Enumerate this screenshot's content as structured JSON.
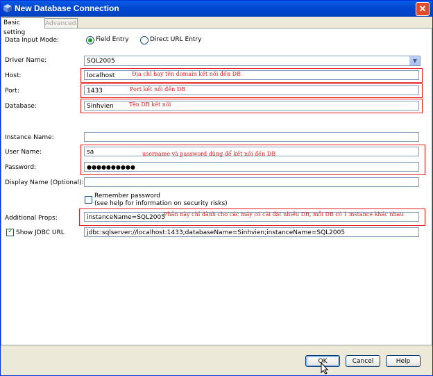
{
  "window": {
    "title": "New Database Connection",
    "close_glyph": "✕"
  },
  "tabs": [
    {
      "label": "Basic setting",
      "active": true
    },
    {
      "label": "Advanced",
      "active": false
    }
  ],
  "form": {
    "data_input_mode": {
      "label": "Data Input Mode:",
      "options": [
        {
          "label": "Field Entry",
          "selected": true
        },
        {
          "label": "Direct URL Entry",
          "selected": false
        }
      ]
    },
    "driver_name": {
      "label": "Driver Name:",
      "value": "SQL2005"
    },
    "host": {
      "label": "Host:",
      "value": "localhost"
    },
    "port": {
      "label": "Port:",
      "value": "1433"
    },
    "database": {
      "label": "Database:",
      "value": "Sinhvien"
    },
    "instance_name": {
      "label": "Instance Name:",
      "value": ""
    },
    "user_name": {
      "label": "User Name:",
      "value": "sa"
    },
    "password": {
      "label": "Password:",
      "value": "●●●●●●●●●●"
    },
    "display_name": {
      "label": "Display Name (Optional):",
      "value": ""
    },
    "remember_password": {
      "label_line1": "Remember password",
      "label_line2": "(see help for information on security risks)",
      "checked": false
    },
    "additional_props": {
      "label": "Additional Props:",
      "value": "instanceName=SQL2005"
    },
    "show_jdbc_url": {
      "label": "Show JDBC URL",
      "checked": true,
      "value": "jdbc:sqlserver://localhost:1433;databaseName=Sinhvien;instanceName=SQL2005"
    }
  },
  "annotations": {
    "host": "Địa chỉ hay tên domain kết nối đến DB",
    "port": "Port kết nối đến DB",
    "database": "Tên DB kết nối",
    "credentials": "username và password dùng để kết nối đến DB",
    "props": "Phần này chỉ dành cho các máy có cài đặt nhiều DB, mỗi DB có 1 instance khác nhau"
  },
  "buttons": {
    "ok": "OK",
    "cancel": "Cancel",
    "help": "Help"
  },
  "colors": {
    "titlebar": "#0048d1",
    "annotation_red": "#e51a1a",
    "dialog_bg": "#ece9d8"
  },
  "icons": {
    "title": "netbeans-cube-icon",
    "close": "close-icon",
    "combo": "chevron-down-icon",
    "cursor": "mouse-pointer-icon"
  }
}
